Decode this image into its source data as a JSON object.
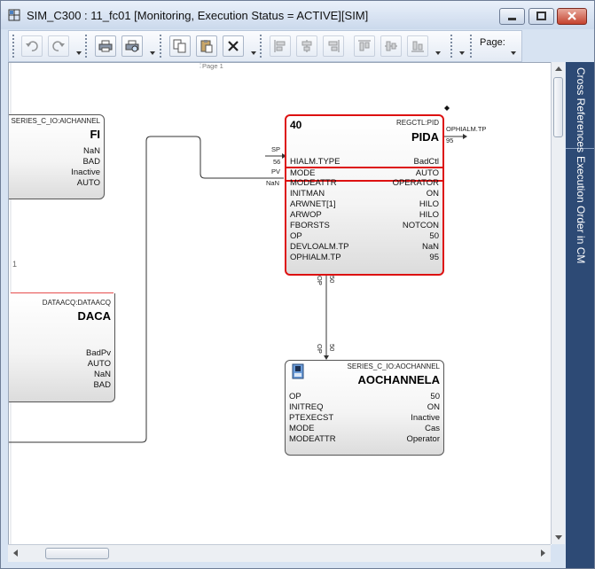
{
  "window": {
    "title": "SIM_C300 : 11_fc01 [Monitoring, Execution Status = ACTIVE][SIM]"
  },
  "toolbar": {
    "page_label": "Page:",
    "buttons": [
      "undo-icon",
      "redo-icon",
      "print-icon",
      "print-preview-icon",
      "copy-icon",
      "paste-icon",
      "delete-icon",
      "align-left-icon",
      "align-center-icon",
      "align-right-icon",
      "align-top-icon",
      "align-middle-icon",
      "align-bottom-icon"
    ]
  },
  "canvas": {
    "page_marker": "Page 1",
    "left_margin_label": "1"
  },
  "side_tabs": [
    "Cross References",
    "Execution Order in CM"
  ],
  "blocks": {
    "fi": {
      "type": "SERIES_C_IO:AICHANNEL",
      "name": "FI",
      "values": [
        "NaN",
        "BAD",
        "Inactive",
        "AUTO"
      ]
    },
    "daca": {
      "type": "DATAACQ:DATAACQ",
      "name": "DACA",
      "values": [
        "BadPv",
        "AUTO",
        "NaN",
        "BAD"
      ]
    },
    "pida": {
      "order": "40",
      "type": "REGCTL:PID",
      "name": "PIDA",
      "params": [
        {
          "k": "HIALM.TYPE",
          "v": "BadCtl"
        },
        {
          "k": "MODE",
          "v": "AUTO"
        },
        {
          "k": "MODEATTR",
          "v": "OPERATOR"
        },
        {
          "k": "INITMAN",
          "v": "ON"
        },
        {
          "k": "ARWNET[1]",
          "v": "HILO"
        },
        {
          "k": "ARWOP",
          "v": "HILO"
        },
        {
          "k": "FBORSTS",
          "v": "NOTCON"
        },
        {
          "k": "OP",
          "v": "50"
        },
        {
          "k": "DEVLOALM.TP",
          "v": "NaN"
        },
        {
          "k": "OPHIALM.TP",
          "v": "95"
        }
      ],
      "inputs": {
        "sp_label": "SP",
        "sp_value": "56",
        "pv_label": "PV",
        "pv_value": "NaN"
      },
      "output": {
        "label": "OPHIALM.TP",
        "value": "95"
      },
      "op_out": {
        "label": "OP",
        "value": "50"
      }
    },
    "aochannela": {
      "type": "SERIES_C_IO:AOCHANNEL",
      "name": "AOCHANNELA",
      "params": [
        {
          "k": "OP",
          "v": "50"
        },
        {
          "k": "INITREQ",
          "v": "ON"
        },
        {
          "k": "PTEXECST",
          "v": "Inactive"
        },
        {
          "k": "MODE",
          "v": "Cas"
        },
        {
          "k": "MODEATTR",
          "v": "Operator"
        }
      ],
      "op_in": {
        "label": "OP",
        "value": "50"
      }
    }
  }
}
